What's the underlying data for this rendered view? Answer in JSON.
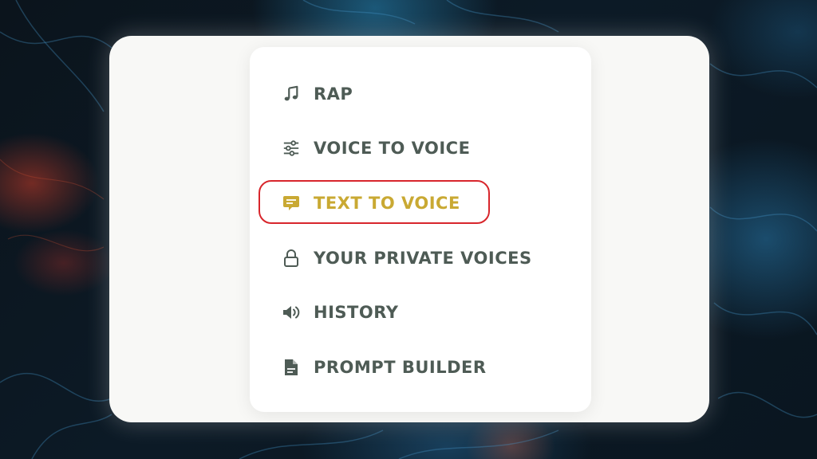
{
  "menu": {
    "items": [
      {
        "label": "RAP",
        "icon": "music-note-icon",
        "active": false
      },
      {
        "label": "VOICE TO VOICE",
        "icon": "sliders-icon",
        "active": false
      },
      {
        "label": "TEXT TO VOICE",
        "icon": "chat-bubble-icon",
        "active": true
      },
      {
        "label": "YOUR PRIVATE VOICES",
        "icon": "lock-icon",
        "active": false
      },
      {
        "label": "HISTORY",
        "icon": "speaker-icon",
        "active": false
      },
      {
        "label": "PROMPT BUILDER",
        "icon": "document-icon",
        "active": false
      }
    ]
  },
  "colors": {
    "text": "#4e5b55",
    "active": "#c9a933",
    "highlight_ring": "#d8262c",
    "panel": "#ffffff",
    "card": "#f8f8f6"
  }
}
